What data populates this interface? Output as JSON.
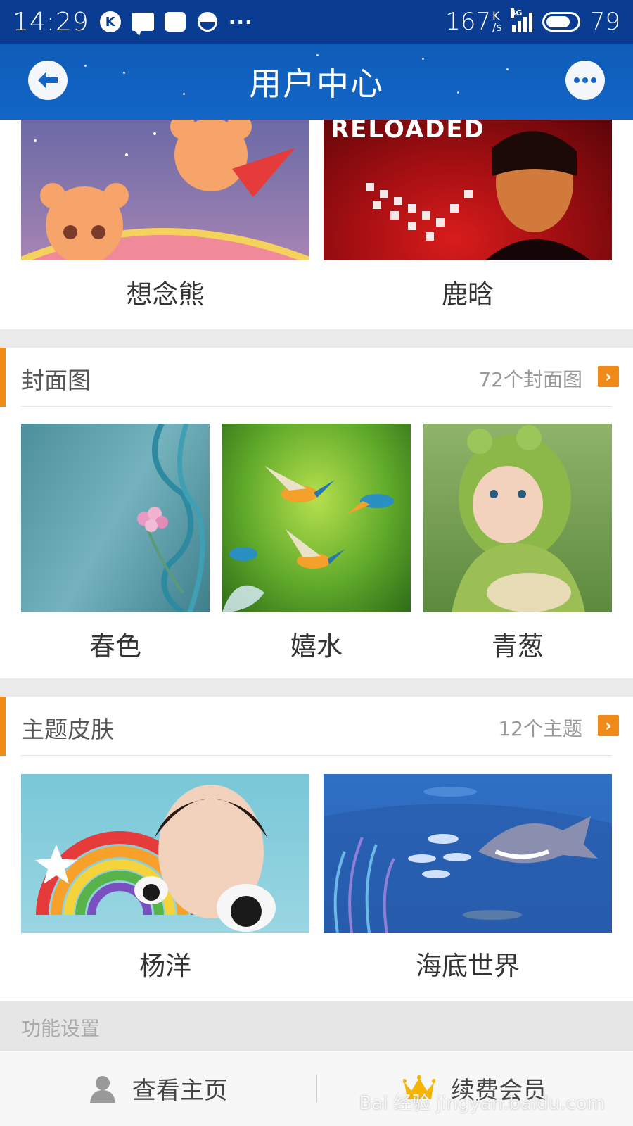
{
  "status_bar": {
    "time": "14:29",
    "speed": "167",
    "speed_unit_top": "K",
    "speed_unit_bottom": "/s",
    "network": "4G",
    "battery": "79",
    "battery_level": 0.79,
    "overflow": "···",
    "k_icon_letter": "K"
  },
  "nav": {
    "title": "用户中心"
  },
  "pendants": {
    "items": [
      {
        "label": "想念熊",
        "icon": "bear-illustration"
      },
      {
        "label": "鹿晗",
        "icon": "portrait-photo",
        "overlay_text": "RELOADED"
      }
    ]
  },
  "covers": {
    "title": "封面图",
    "count": "72个封面图",
    "items": [
      {
        "label": "春色"
      },
      {
        "label": "嬉水"
      },
      {
        "label": "青葱"
      }
    ]
  },
  "themes": {
    "title": "主题皮肤",
    "count": "12个主题",
    "items": [
      {
        "label": "杨洋"
      },
      {
        "label": "海底世界"
      }
    ]
  },
  "settings": {
    "label": "功能设置"
  },
  "bottom_bar": {
    "home_label": "查看主页",
    "vip_label": "续费会员"
  },
  "watermark": "Bai 经验 jingyan.baidu.com",
  "colors": {
    "status_bg": "#0a3d91",
    "nav_bg": "#1366c7",
    "accent": "#f28a1a",
    "crown": "#f5b400"
  }
}
